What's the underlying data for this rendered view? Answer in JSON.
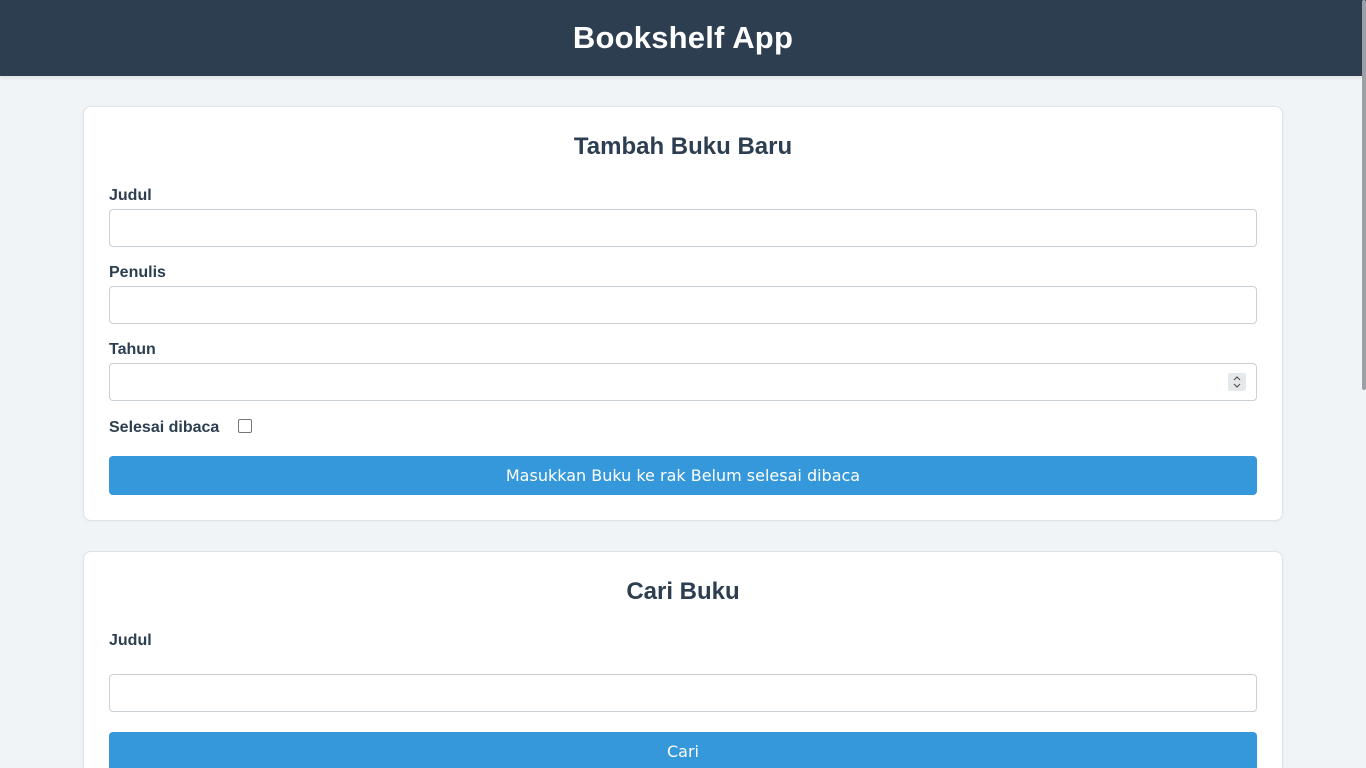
{
  "header": {
    "title": "Bookshelf App"
  },
  "add_book": {
    "title": "Tambah Buku Baru",
    "title_label": "Judul",
    "title_value": "",
    "author_label": "Penulis",
    "author_value": "",
    "year_label": "Tahun",
    "year_value": "",
    "complete_label": "Selesai dibaca",
    "complete_checked": false,
    "submit_label": "Masukkan Buku ke rak Belum selesai dibaca"
  },
  "search_book": {
    "title": "Cari Buku",
    "title_label": "Judul",
    "title_value": "",
    "submit_label": "Cari"
  },
  "colors": {
    "header_bg": "#2c3e50",
    "accent": "#3498db",
    "page_bg": "#f1f4f7"
  }
}
